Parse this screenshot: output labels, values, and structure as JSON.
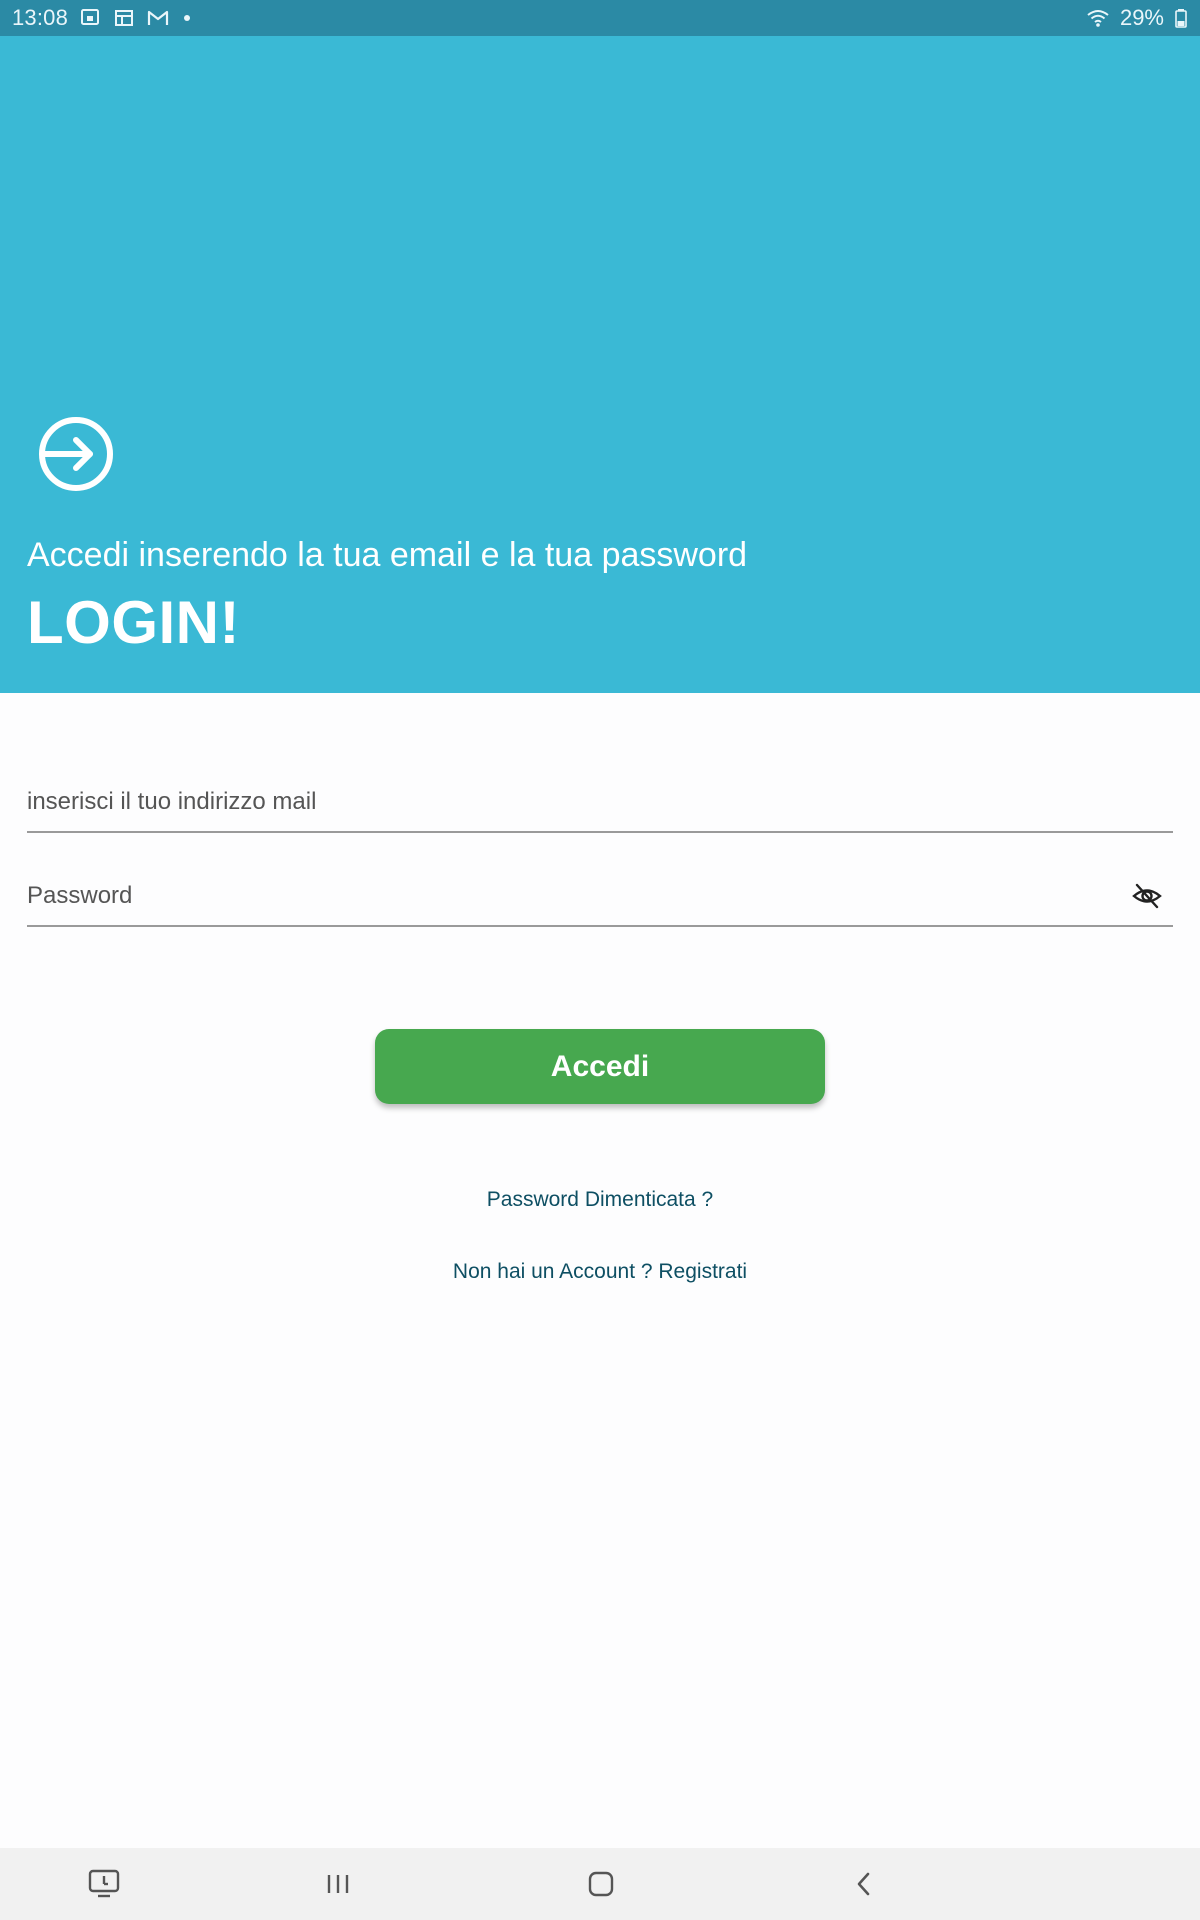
{
  "status_bar": {
    "time": "13:08",
    "battery": "29%",
    "icons": [
      "screen-mirror-icon",
      "calendar-icon",
      "gmail-icon",
      "wifi-icon",
      "battery-icon"
    ]
  },
  "hero": {
    "subtitle": "Accedi inserendo la tua email e la tua password",
    "title": "LOGIN!",
    "icon": "login-arrow-icon",
    "background": "#3ab9d5"
  },
  "form": {
    "email_placeholder": "inserisci il tuo indirizzo mail",
    "email_value": "",
    "password_placeholder": "Password",
    "password_value": "",
    "password_toggle_icon": "eye-off-icon"
  },
  "actions": {
    "login_label": "Accedi",
    "login_color": "#47a84f",
    "forgot_label": "Password Dimenticata ?",
    "register_label": "Non hai un Account ? Registrati",
    "link_color": "#0e4f63"
  },
  "nav_bar": {
    "icons": [
      "screen-mirror-icon",
      "recents-icon",
      "home-icon",
      "back-icon"
    ]
  }
}
